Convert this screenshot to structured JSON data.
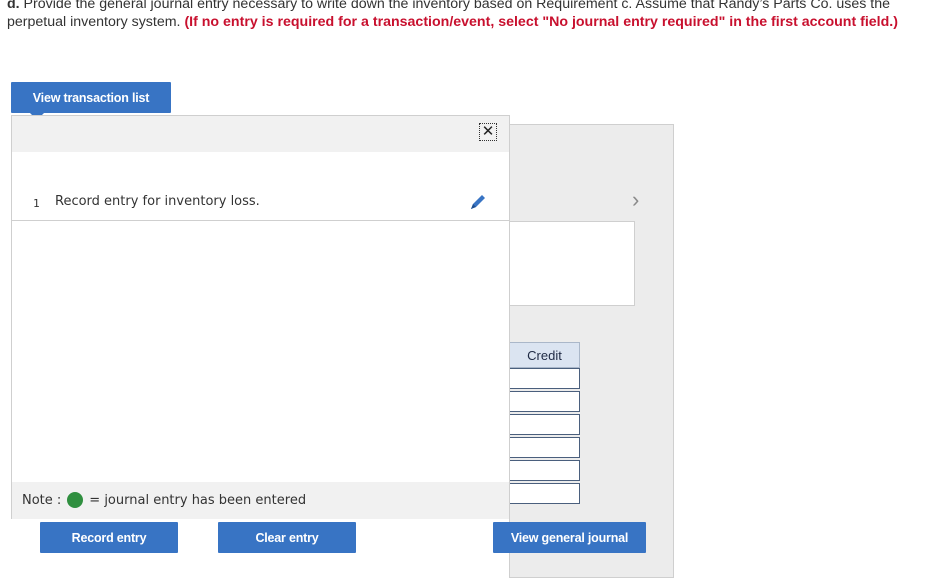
{
  "instructions": {
    "lead": "d.",
    "text": " Provide the general journal entry necessary to write down the inventory based on Requirement c. Assume that Randy’s Parts Co. uses the perpetual inventory system. ",
    "red": "(If no entry is required for a transaction/event, select \"No journal entry required\" in the first account field.)"
  },
  "buttons": {
    "view_transaction_list": "View transaction list",
    "record_entry": "Record entry",
    "clear_entry": "Clear entry",
    "view_general_journal": "View general journal"
  },
  "transaction_list": {
    "close_glyph": "✕",
    "rows": [
      {
        "number": "1",
        "description": "Record entry for inventory loss."
      }
    ]
  },
  "journal": {
    "chevron_glyph": "›",
    "credit_header": "Credit"
  },
  "note": {
    "prefix": "Note :",
    "suffix": "= journal entry has been entered",
    "dot_color": "#2f8f3f"
  },
  "colors": {
    "accent": "#3874c4",
    "instruction_red": "#c8102e"
  },
  "icons": [
    "close-icon",
    "pencil-icon",
    "chevron-right-icon",
    "green-dot-icon"
  ]
}
